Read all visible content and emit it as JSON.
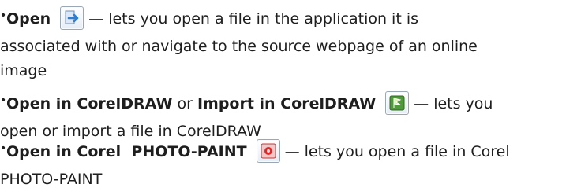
{
  "bullets": [
    {
      "term": "Open",
      "icon": "open-file-icon",
      "line1_tail": "— lets you open a file in the application it is",
      "line2": "associated with or navigate to the source webpage of an online",
      "line3": "image"
    },
    {
      "term_a": "Open in CorelDRAW",
      "joiner": "or",
      "term_b": "Import in CorelDRAW",
      "icon": "coreldraw-icon",
      "line1_tail": "— lets you",
      "line2": "open or import a file in CorelDRAW"
    },
    {
      "term": "Open in Corel  PHOTO-PAINT",
      "icon": "photo-paint-icon",
      "line1_tail": "— lets you open a file in Corel",
      "line2": "PHOTO-PAINT"
    }
  ],
  "bullet_glyph": "•",
  "colors": {
    "text": "#1e1e1e",
    "icon_border": "#9aa7b4"
  }
}
